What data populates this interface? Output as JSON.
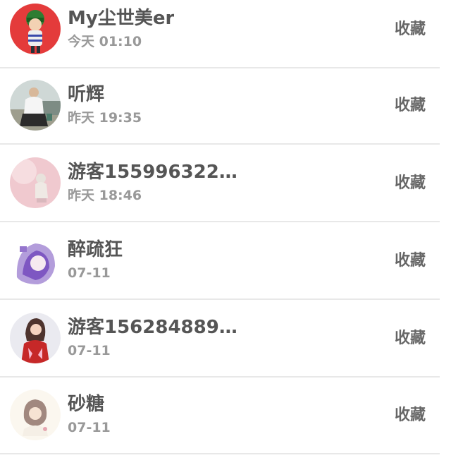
{
  "items": [
    {
      "name": "My尘世美er",
      "time": "今天 01:10",
      "action": "收藏",
      "avatar": "avatar-red-cartoon-girl"
    },
    {
      "name": "听辉",
      "time": "昨天 19:35",
      "action": "收藏",
      "avatar": "avatar-person-outdoor"
    },
    {
      "name": "游客155996322…",
      "time": "昨天 18:46",
      "action": "收藏",
      "avatar": "avatar-pink-figure"
    },
    {
      "name": "醉疏狂",
      "time": "07-11",
      "action": "收藏",
      "avatar": "avatar-purple-hair-girl"
    },
    {
      "name": "游客156284889…",
      "time": "07-11",
      "action": "收藏",
      "avatar": "avatar-woman-red-dress"
    },
    {
      "name": "砂糖",
      "time": "07-11",
      "action": "收藏",
      "avatar": "avatar-illustrated-girl"
    }
  ],
  "colors": {
    "name_text": "#555555",
    "time_text": "#999999",
    "action_text": "#666666",
    "divider": "#e8e8e8"
  }
}
